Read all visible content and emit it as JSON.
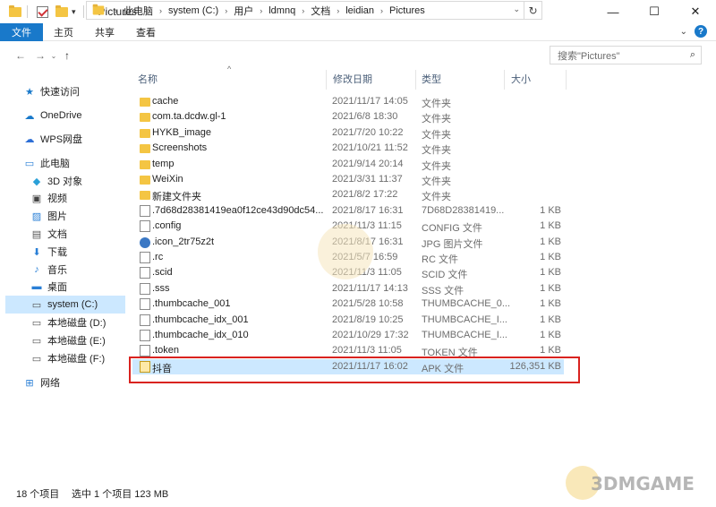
{
  "window": {
    "title": "Pictures",
    "controls": [
      "—",
      "☐",
      "✕"
    ]
  },
  "ribbon": {
    "tabs": [
      "文件",
      "主页",
      "共享",
      "查看"
    ]
  },
  "address": {
    "crumbs": [
      "此电脑",
      "system (C:)",
      "用户",
      "ldmnq",
      "文档",
      "leidian",
      "Pictures"
    ],
    "search_placeholder": "搜索\"Pictures\""
  },
  "sidebar": {
    "items": [
      {
        "label": "快速访问",
        "icon": "star-icon"
      },
      {
        "label": "OneDrive",
        "icon": "cloud-icon"
      },
      {
        "label": "WPS网盘",
        "icon": "cloud-icon"
      },
      {
        "label": "此电脑",
        "icon": "computer-icon"
      },
      {
        "label": "3D 对象",
        "icon": "cube-icon"
      },
      {
        "label": "视频",
        "icon": "video-icon"
      },
      {
        "label": "图片",
        "icon": "picture-icon"
      },
      {
        "label": "文档",
        "icon": "document-icon"
      },
      {
        "label": "下载",
        "icon": "download-icon"
      },
      {
        "label": "音乐",
        "icon": "music-icon"
      },
      {
        "label": "桌面",
        "icon": "desktop-icon"
      },
      {
        "label": "system (C:)",
        "icon": "drive-icon"
      },
      {
        "label": "本地磁盘 (D:)",
        "icon": "drive-icon"
      },
      {
        "label": "本地磁盘 (E:)",
        "icon": "drive-icon"
      },
      {
        "label": "本地磁盘 (F:)",
        "icon": "drive-icon"
      },
      {
        "label": "网络",
        "icon": "network-icon"
      }
    ]
  },
  "columns": {
    "name": "名称",
    "date": "修改日期",
    "type": "类型",
    "size": "大小"
  },
  "files": [
    {
      "name": "cache",
      "date": "2021/11/17 14:05",
      "type": "文件夹",
      "size": "",
      "icon": "folder-icon"
    },
    {
      "name": "com.ta.dcdw.gl-1",
      "date": "2021/6/8 18:30",
      "type": "文件夹",
      "size": "",
      "icon": "folder-icon"
    },
    {
      "name": "HYKB_image",
      "date": "2021/7/20 10:22",
      "type": "文件夹",
      "size": "",
      "icon": "folder-icon"
    },
    {
      "name": "Screenshots",
      "date": "2021/10/21 11:52",
      "type": "文件夹",
      "size": "",
      "icon": "folder-icon"
    },
    {
      "name": "temp",
      "date": "2021/9/14 20:14",
      "type": "文件夹",
      "size": "",
      "icon": "folder-icon"
    },
    {
      "name": "WeiXin",
      "date": "2021/3/31 11:37",
      "type": "文件夹",
      "size": "",
      "icon": "folder-icon"
    },
    {
      "name": "新建文件夹",
      "date": "2021/8/2 17:22",
      "type": "文件夹",
      "size": "",
      "icon": "folder-icon"
    },
    {
      "name": ".7d68d28381419ea0f12ce43d90dc54...",
      "date": "2021/8/17 16:31",
      "type": "7D68D28381419...",
      "size": "1 KB",
      "icon": "file-icon"
    },
    {
      "name": ".config",
      "date": "2021/11/3 11:15",
      "type": "CONFIG 文件",
      "size": "1 KB",
      "icon": "file-icon"
    },
    {
      "name": ".icon_2tr75z2t",
      "date": "2021/8/17 16:31",
      "type": "JPG 图片文件",
      "size": "1 KB",
      "icon": "image-icon"
    },
    {
      "name": ".rc",
      "date": "2021/5/7 16:59",
      "type": "RC 文件",
      "size": "1 KB",
      "icon": "file-icon"
    },
    {
      "name": ".scid",
      "date": "2021/11/3 11:05",
      "type": "SCID 文件",
      "size": "1 KB",
      "icon": "file-icon"
    },
    {
      "name": ".sss",
      "date": "2021/11/17 14:13",
      "type": "SSS 文件",
      "size": "1 KB",
      "icon": "file-icon"
    },
    {
      "name": ".thumbcache_001",
      "date": "2021/5/28 10:58",
      "type": "THUMBCACHE_0...",
      "size": "1 KB",
      "icon": "file-icon"
    },
    {
      "name": ".thumbcache_idx_001",
      "date": "2021/8/19 10:25",
      "type": "THUMBCACHE_I...",
      "size": "1 KB",
      "icon": "file-icon"
    },
    {
      "name": ".thumbcache_idx_010",
      "date": "2021/10/29 17:32",
      "type": "THUMBCACHE_I...",
      "size": "1 KB",
      "icon": "file-icon"
    },
    {
      "name": ".token",
      "date": "2021/11/3 11:05",
      "type": "TOKEN 文件",
      "size": "1 KB",
      "icon": "file-icon"
    },
    {
      "name": "抖音",
      "date": "2021/11/17 16:02",
      "type": "APK 文件",
      "size": "126,351 KB",
      "icon": "apk-icon",
      "selected": true
    }
  ],
  "status": {
    "item_count": "18 个项目",
    "selection": "选中 1 个项目  123 MB"
  },
  "watermark": "3DMGAME",
  "colors": {
    "accent": "#1979ca",
    "selection": "#cce8ff",
    "highlight_box": "#d9231f",
    "folder": "#f4c543"
  }
}
